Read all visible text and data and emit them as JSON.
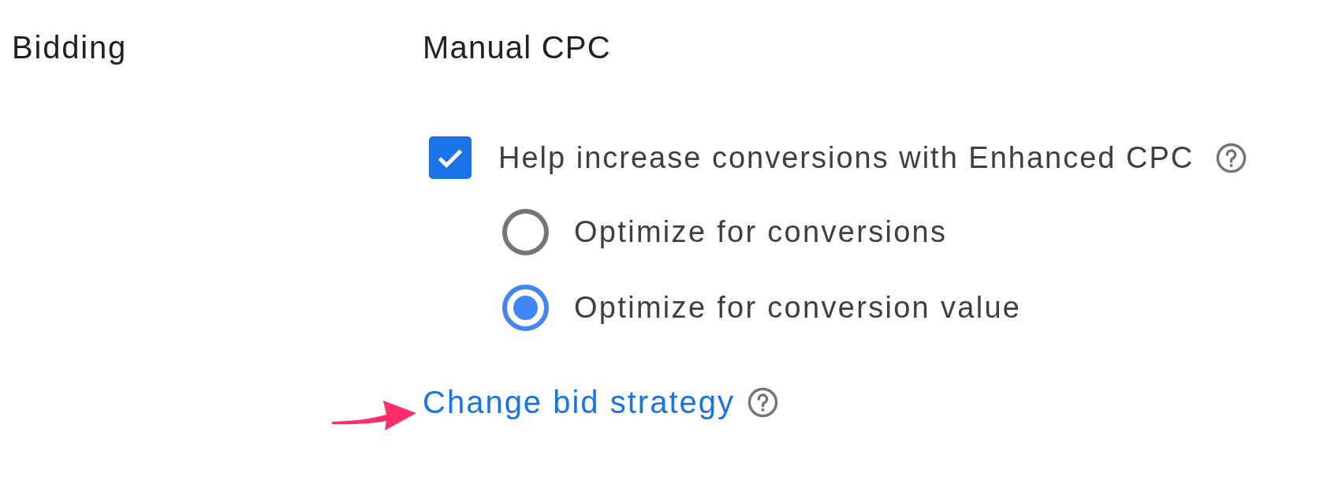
{
  "section": {
    "label": "Bidding",
    "strategy": "Manual CPC",
    "enhanced_cpc": {
      "label": "Help increase conversions with Enhanced CPC",
      "checked": true
    },
    "options": [
      {
        "label": "Optimize for conversions",
        "selected": false
      },
      {
        "label": "Optimize for conversion value",
        "selected": true
      }
    ],
    "link": "Change bid strategy"
  }
}
